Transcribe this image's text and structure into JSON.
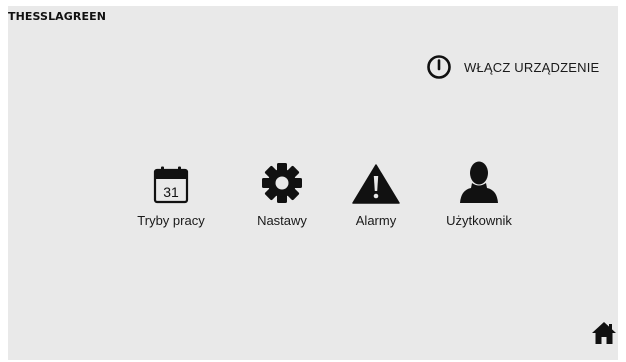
{
  "header": {
    "brand": "THESSLAGREEN"
  },
  "power": {
    "label": "WŁĄCZ URZĄDZENIE",
    "icon": "power-icon"
  },
  "menu": {
    "items": [
      {
        "label": "Tryby pracy",
        "icon": "calendar-icon",
        "calendar_day": "31"
      },
      {
        "label": "Nastawy",
        "icon": "gear-icon"
      },
      {
        "label": "Alarmy",
        "icon": "warning-icon"
      },
      {
        "label": "Użytkownik",
        "icon": "user-icon"
      }
    ]
  },
  "footer": {
    "home_icon": "home-icon"
  },
  "colors": {
    "background": "#e9e9e9",
    "foreground": "#111111"
  }
}
